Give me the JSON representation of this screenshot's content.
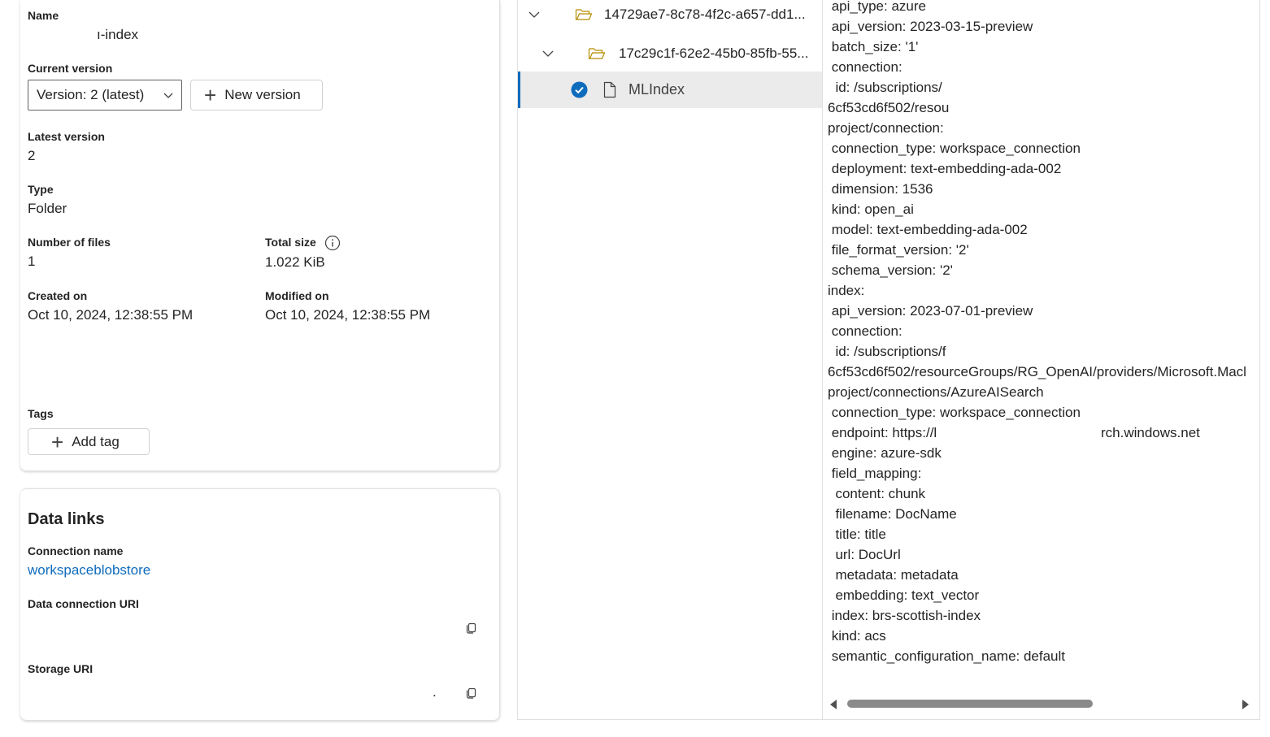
{
  "details": {
    "name_label": "Name",
    "name_value": "ı-index",
    "current_version_label": "Current version",
    "version_select": "Version: 2 (latest)",
    "new_version_button": "New version",
    "latest_version_label": "Latest version",
    "latest_version_value": "2",
    "type_label": "Type",
    "type_value": "Folder",
    "num_files_label": "Number of files",
    "num_files_value": "1",
    "total_size_label": "Total size",
    "total_size_value": "1.022 KiB",
    "created_label": "Created on",
    "created_value": "Oct 10, 2024, 12:38:55 PM",
    "modified_label": "Modified on",
    "modified_value": "Oct 10, 2024, 12:38:55 PM",
    "tags_label": "Tags",
    "add_tag_button": "Add tag"
  },
  "data_links": {
    "title": "Data links",
    "connection_name_label": "Connection name",
    "connection_name_value": "workspaceblobstore",
    "data_connection_uri_label": "Data connection URI",
    "storage_uri_label": "Storage URI",
    "storage_uri_value": "."
  },
  "tree": {
    "items": [
      {
        "label": "14729ae7-8c78-4f2c-a657-dd1..."
      },
      {
        "label": "17c29c1f-62e2-45b0-85fb-55..."
      },
      {
        "label": "MLIndex"
      }
    ]
  },
  "yaml": {
    "lines": [
      " api_type: azure",
      " api_version: 2023-03-15-preview",
      " batch_size: '1'",
      " connection:",
      "  id: /subscriptions/",
      "6cf53cd6f502/resou",
      "project/connection:",
      " connection_type: workspace_connection",
      " deployment: text-embedding-ada-002",
      " dimension: 1536",
      " kind: open_ai",
      " model: text-embedding-ada-002",
      " file_format_version: '2'",
      " schema_version: '2'",
      "index:",
      " api_version: 2023-07-01-preview",
      " connection:",
      "  id: /subscriptions/f",
      "6cf53cd6f502/resourceGroups/RG_OpenAI/providers/Microsoft.Macl",
      "project/connections/AzureAISearch",
      " connection_type: workspace_connection",
      " endpoint: https://l",
      " engine: azure-sdk",
      " field_mapping:",
      "  content: chunk",
      "  filename: DocName",
      "  title: title",
      "  url: DocUrl",
      "  metadata: metadata",
      "  embedding: text_vector",
      " index: brs-scottish-index",
      " kind: acs",
      " semantic_configuration_name: default"
    ],
    "endpoint_tail": "rch.windows.net"
  }
}
